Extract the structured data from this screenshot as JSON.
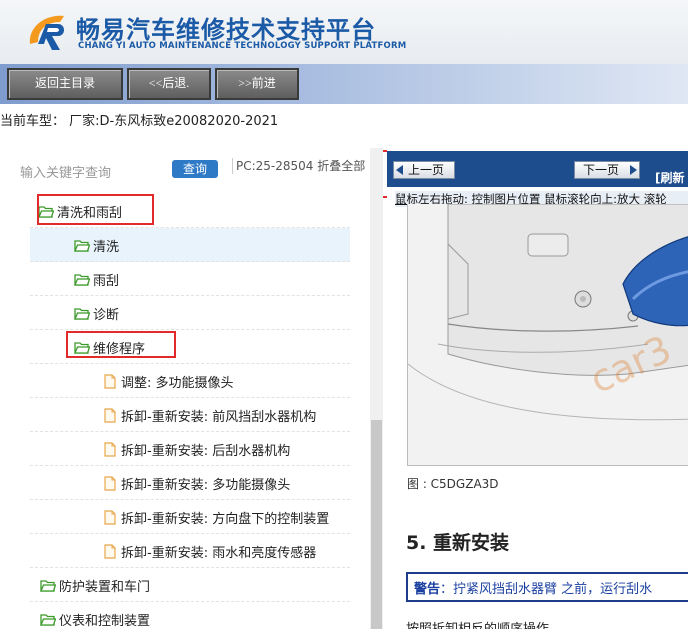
{
  "header": {
    "brand_title": "畅易汽车维修技术支持平台",
    "brand_subtitle": "CHANG YI AUTO MAINTENANCE TECHNOLOGY SUPPORT PLATFORM",
    "accent_color": "#1b5aa6"
  },
  "nav": {
    "home_label": "返回主目录",
    "back_label": "<<后退.",
    "forward_label": ">>前进"
  },
  "car_model": "当前车型： 厂家:D-东风标致e20082020-2021",
  "search": {
    "placeholder": "输入关键字查询",
    "button_label": "查询",
    "pc_info": "PC:25-28504 折叠全部"
  },
  "tree": [
    {
      "label": "清洗和雨刮",
      "icon": "folder-open-icon"
    },
    {
      "label": "清洗",
      "icon": "folder-open-icon"
    },
    {
      "label": "雨刮",
      "icon": "folder-open-icon"
    },
    {
      "label": "诊断",
      "icon": "folder-open-icon"
    },
    {
      "label": "维修程序",
      "icon": "folder-open-icon"
    },
    {
      "label": "调整: 多功能摄像头",
      "icon": "document-icon"
    },
    {
      "label": "拆卸-重新安装: 前风挡刮水器机构",
      "icon": "document-icon"
    },
    {
      "label": "拆卸-重新安装: 后刮水器机构",
      "icon": "document-icon"
    },
    {
      "label": "拆卸-重新安装: 多功能摄像头",
      "icon": "document-icon"
    },
    {
      "label": "拆卸-重新安装: 方向盘下的控制装置",
      "icon": "document-icon"
    },
    {
      "label": "拆卸-重新安装: 雨水和亮度传感器",
      "icon": "document-icon"
    },
    {
      "label": "防护装置和车门",
      "icon": "folder-open-icon"
    },
    {
      "label": "仪表和控制装置",
      "icon": "folder-open-icon"
    }
  ],
  "viewer": {
    "prev_label": "上一页",
    "next_label": "下一页",
    "refresh_label": "[刷新",
    "hint": "鼠标左右拖动: 控制图片位置 鼠标滚轮向上:放大  滚轮",
    "watermark": "car3",
    "figure_caption": "图 : C5DGZA3D",
    "section_heading": "5. 重新安装",
    "warning_label": "警告",
    "warning_text": "：拧紧风挡刮水器臂 之前，运行刮水",
    "paragraph": "按照拆卸相反的顺序操作"
  }
}
